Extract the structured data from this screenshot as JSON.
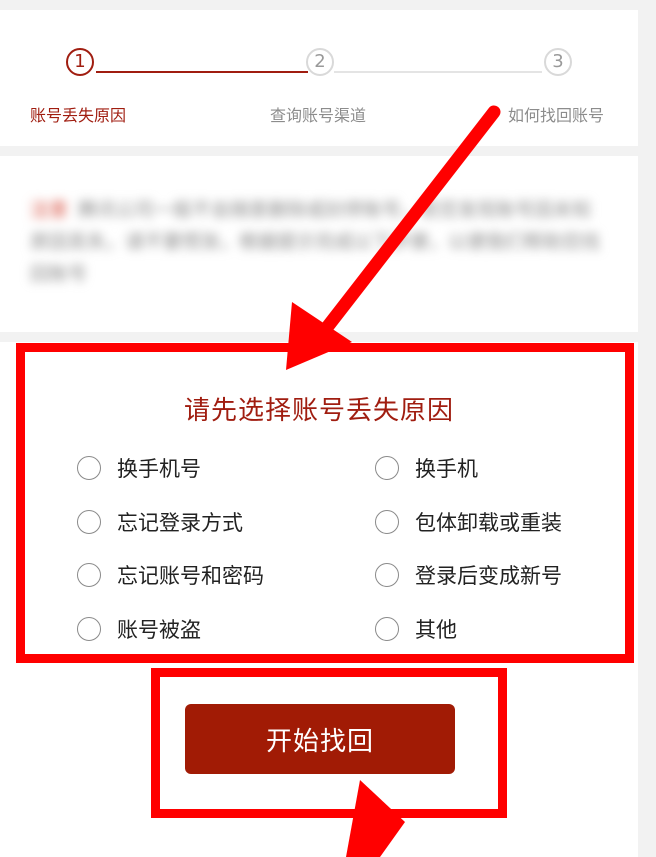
{
  "steps": [
    {
      "number": "1",
      "label": "账号丢失原因",
      "state": "active"
    },
    {
      "number": "2",
      "label": "查询账号渠道",
      "state": "inactive"
    },
    {
      "number": "3",
      "label": "如何找回账号",
      "state": "inactive"
    }
  ],
  "notice": {
    "tag": "注意",
    "text": "腾讯公司一般不会随意删除或封停账号，若您发现账号因未知原因丢失，请不要慌张，根据提示完成以下步骤，以便我们帮助您找回账号"
  },
  "reason": {
    "title": "请先选择账号丢失原因",
    "options": [
      {
        "label": "换手机号",
        "selected": false
      },
      {
        "label": "换手机",
        "selected": false
      },
      {
        "label": "忘记登录方式",
        "selected": false
      },
      {
        "label": "包体卸载或重装",
        "selected": false
      },
      {
        "label": "忘记账号和密码",
        "selected": false
      },
      {
        "label": "登录后变成新号",
        "selected": false
      },
      {
        "label": "账号被盗",
        "selected": false
      },
      {
        "label": "其他",
        "selected": false
      }
    ]
  },
  "action": {
    "start_label": "开始找回"
  },
  "colors": {
    "accent": "#a01d10",
    "button": "#a11b05",
    "highlight": "#ff0000"
  }
}
